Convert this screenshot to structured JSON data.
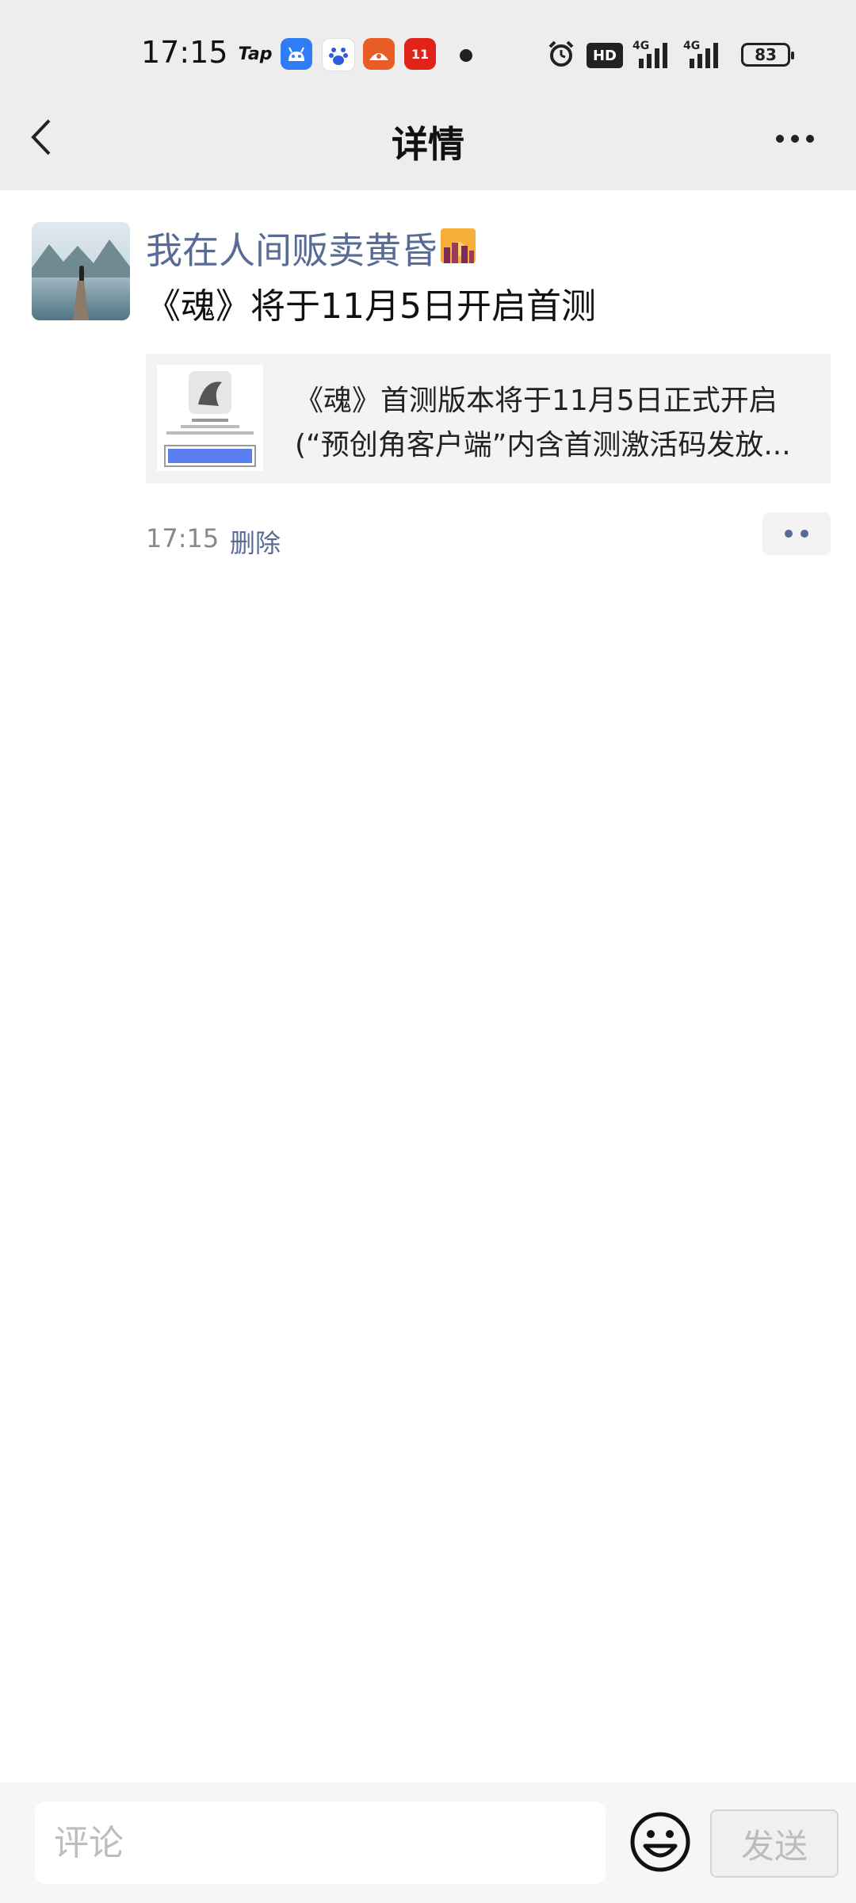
{
  "status_bar": {
    "time": "17:15",
    "tap_label": "Tap",
    "hd_label": "HD",
    "battery": "83",
    "icons": [
      "tap-icon",
      "android-icon",
      "baidu-icon",
      "taobao-icon",
      "tmall-icon",
      "dot-icon",
      "alarm-icon",
      "hd-icon",
      "signal-4g-icon",
      "signal-4g-icon",
      "battery-icon"
    ]
  },
  "nav": {
    "title": "详情",
    "back_icon": "chevron-left-icon",
    "more_icon": "more-icon"
  },
  "post": {
    "username": "我在人间贩卖黄昏",
    "text": "《魂》将于11月5日开启首测",
    "link": {
      "line1": "《魂》首测版本将于11月5日正式开启",
      "line2": "(“预创角客户端”内含首测激活码发放..."
    },
    "time": "17:15",
    "delete_label": "删除"
  },
  "comment_bar": {
    "placeholder": "评论",
    "send_label": "发送",
    "emoji_icon": "smiley-icon"
  },
  "colors": {
    "header_bg": "#ededed",
    "link_blue": "#576b95",
    "card_bg": "#f3f3f3"
  }
}
